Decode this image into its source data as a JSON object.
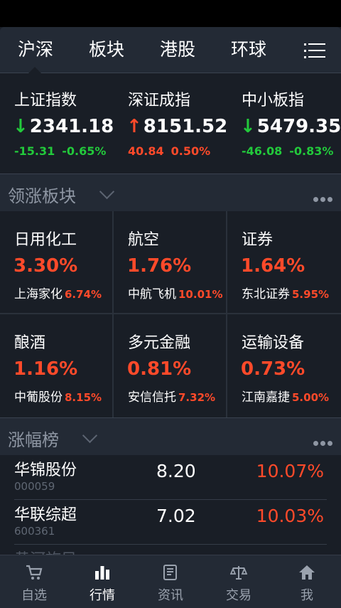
{
  "tabs": [
    {
      "label": "沪深",
      "active": true
    },
    {
      "label": "板块",
      "active": false
    },
    {
      "label": "港股",
      "active": false
    },
    {
      "label": "环球",
      "active": false
    }
  ],
  "indices": [
    {
      "name": "上证指数",
      "arrow": "↓",
      "value": "2341.18",
      "change": "-15.31",
      "percent": "-0.65%",
      "dir": "down"
    },
    {
      "name": "深证成指",
      "arrow": "↑",
      "value": "8151.52",
      "change": "40.84",
      "percent": "0.50%",
      "dir": "up"
    },
    {
      "name": "中小板指",
      "arrow": "↓",
      "value": "5479.35",
      "change": "-46.08",
      "percent": "-0.83%",
      "dir": "down"
    }
  ],
  "sectors_header": {
    "title": "领涨板块"
  },
  "sectors": [
    {
      "name": "日用化工",
      "percent": "3.30%",
      "stock": "上海家化",
      "stock_pct": "6.74%"
    },
    {
      "name": "航空",
      "percent": "1.76%",
      "stock": "中航飞机",
      "stock_pct": "10.01%"
    },
    {
      "name": "证券",
      "percent": "1.64%",
      "stock": "东北证券",
      "stock_pct": "5.95%"
    },
    {
      "name": "酿酒",
      "percent": "1.16%",
      "stock": "中葡股份",
      "stock_pct": "8.15%"
    },
    {
      "name": "多元金融",
      "percent": "0.81%",
      "stock": "安信信托",
      "stock_pct": "7.32%"
    },
    {
      "name": "运输设备",
      "percent": "0.73%",
      "stock": "江南嘉捷",
      "stock_pct": "5.00%"
    }
  ],
  "gainers_header": {
    "title": "涨幅榜"
  },
  "gainers": [
    {
      "name": "华锦股份",
      "code": "000059",
      "price": "8.20",
      "percent": "10.07%"
    },
    {
      "name": "华联综超",
      "code": "600361",
      "price": "7.02",
      "percent": "10.03%"
    },
    {
      "name": "黄河旋风",
      "code": "",
      "price": "",
      "percent": ""
    }
  ],
  "bottom_nav": [
    {
      "label": "自选",
      "icon": "cart-icon",
      "active": false
    },
    {
      "label": "行情",
      "icon": "bar-chart-icon",
      "active": true
    },
    {
      "label": "资讯",
      "icon": "scroll-icon",
      "active": false
    },
    {
      "label": "交易",
      "icon": "scale-icon",
      "active": false
    },
    {
      "label": "我",
      "icon": "home-icon",
      "active": false
    }
  ],
  "colors": {
    "up": "#ff4a2a",
    "down": "#22c93b",
    "background": "#191e26",
    "panel": "#232a35"
  }
}
